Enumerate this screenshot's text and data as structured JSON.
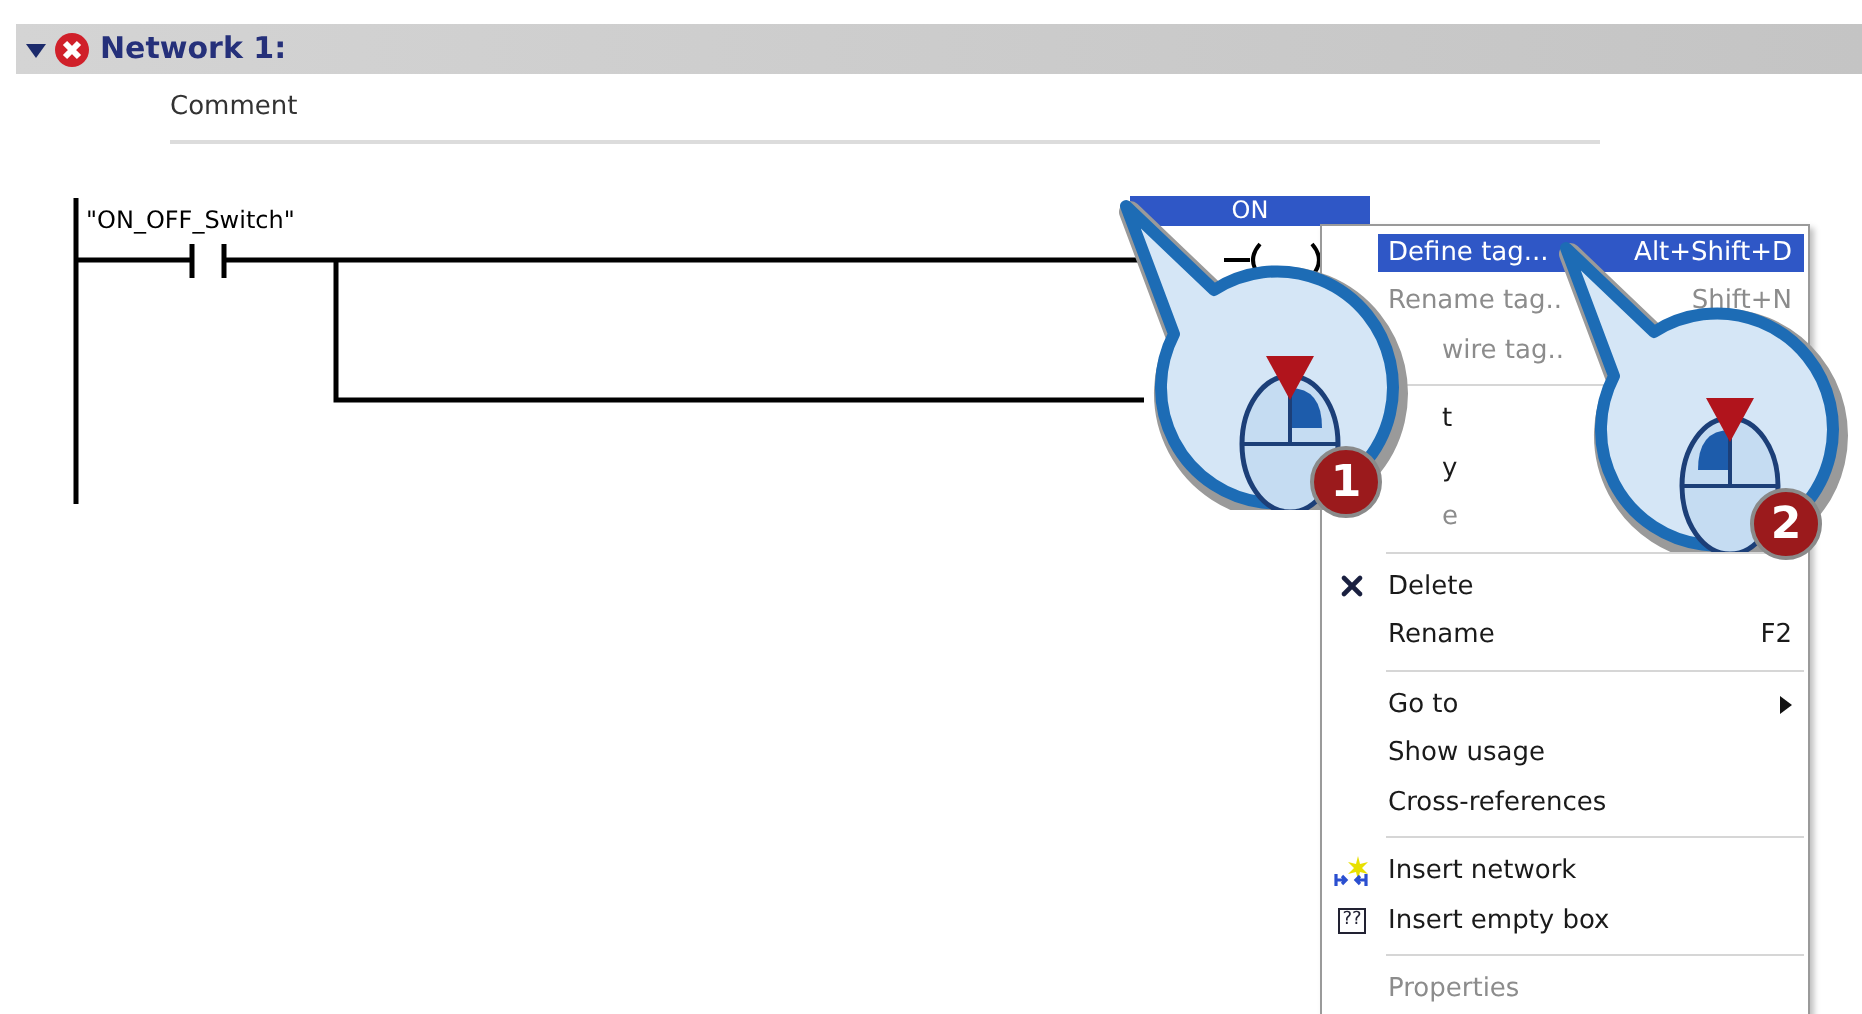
{
  "network": {
    "title": "Network 1:",
    "expanded": true,
    "error": true,
    "comment": "Comment"
  },
  "ladder": {
    "contact_tag": "\"ON_OFF_Switch\"",
    "coil_tag": "ON",
    "coil_tag_selected": true
  },
  "context_menu": [
    {
      "kind": "item",
      "label": "Define tag...",
      "shortcut": "Alt+Shift+D",
      "selected": true,
      "disabled": false
    },
    {
      "kind": "item",
      "label": "Rename tag..",
      "shortcut": "Shift+N",
      "selected": false,
      "disabled": true
    },
    {
      "kind": "partial",
      "label": "wire tag..",
      "selected": false,
      "disabled": true
    },
    {
      "kind": "separator"
    },
    {
      "kind": "partial",
      "label": "t",
      "selected": false,
      "disabled": false
    },
    {
      "kind": "partial",
      "label": "y",
      "selected": false,
      "disabled": false
    },
    {
      "kind": "partial",
      "label": "e",
      "selected": false,
      "disabled": true
    },
    {
      "kind": "separator"
    },
    {
      "kind": "delete",
      "label": "Delete",
      "selected": false,
      "disabled": false
    },
    {
      "kind": "item",
      "label": "Rename",
      "shortcut": "F2",
      "selected": false,
      "disabled": false
    },
    {
      "kind": "separator"
    },
    {
      "kind": "item",
      "label": "Go to",
      "submenu": true,
      "selected": false,
      "disabled": false
    },
    {
      "kind": "item",
      "label": "Show usage",
      "selected": false,
      "disabled": false
    },
    {
      "kind": "item",
      "label": "Cross-references",
      "selected": false,
      "disabled": false
    },
    {
      "kind": "separator"
    },
    {
      "kind": "network",
      "label": "Insert network",
      "selected": false,
      "disabled": false
    },
    {
      "kind": "box",
      "label": "Insert empty box",
      "icon_text": "??",
      "selected": false,
      "disabled": false
    },
    {
      "kind": "separator"
    },
    {
      "kind": "item",
      "label": "Properties",
      "selected": false,
      "disabled": true
    }
  ],
  "callouts": [
    {
      "badge": "1"
    },
    {
      "badge": "2"
    }
  ]
}
